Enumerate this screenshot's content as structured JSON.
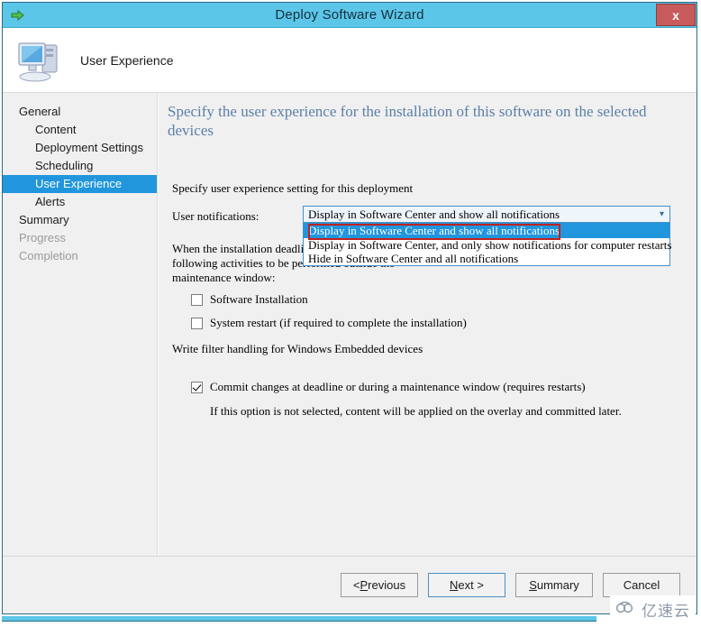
{
  "window": {
    "title": "Deploy Software Wizard",
    "close_label": "x",
    "titlebar_icon": "green-arrow-icon",
    "colors": {
      "titlebar": "#5cc6e8",
      "close_button": "#c75b5b",
      "selection": "#2196dd",
      "heading_text": "#5a7fa8",
      "annotation": "#c0221f"
    }
  },
  "header": {
    "icon": "computer-icon",
    "title": "User Experience"
  },
  "sidebar": {
    "items": [
      {
        "label": "General",
        "indent": false,
        "state": "normal"
      },
      {
        "label": "Content",
        "indent": true,
        "state": "normal"
      },
      {
        "label": "Deployment Settings",
        "indent": true,
        "state": "normal"
      },
      {
        "label": "Scheduling",
        "indent": true,
        "state": "normal"
      },
      {
        "label": "User Experience",
        "indent": true,
        "state": "selected"
      },
      {
        "label": "Alerts",
        "indent": true,
        "state": "normal"
      },
      {
        "label": "Summary",
        "indent": false,
        "state": "normal"
      },
      {
        "label": "Progress",
        "indent": false,
        "state": "disabled"
      },
      {
        "label": "Completion",
        "indent": false,
        "state": "disabled"
      }
    ]
  },
  "main": {
    "heading": "Specify the user experience for the installation of this software on the selected devices",
    "intro": "Specify user experience setting for this deployment",
    "field_label": "User notifications:",
    "combo": {
      "value": "Display in Software Center and show all notifications",
      "arrow_icon": "chevron-down-icon",
      "expanded": true,
      "options": [
        "Display in Software Center and show all notifications",
        "Display in Software Center, and only show notifications for computer restarts",
        "Hide in Software Center and all notifications"
      ],
      "highlighted_index": 0
    },
    "deadline_text": "When the installation deadline is reached, allow the following activities to be performed outside the maintenance window:",
    "checkboxes": [
      {
        "label": "Software Installation",
        "checked": false
      },
      {
        "label": "System restart  (if required to complete the installation)",
        "checked": false
      }
    ],
    "write_filter_heading": "Write filter handling for Windows Embedded devices",
    "commit_checkbox": {
      "label": "Commit changes at deadline or during a maintenance window (requires restarts)",
      "checked": true
    },
    "commit_note": "If this option is not selected, content will be applied on the overlay and committed later."
  },
  "footer": {
    "buttons": [
      {
        "id": "previous",
        "prefix": "< ",
        "accel": "P",
        "rest": "revious",
        "default": false
      },
      {
        "id": "next",
        "prefix": "",
        "accel": "N",
        "rest": "ext >",
        "default": true
      },
      {
        "id": "summary",
        "prefix": "",
        "accel": "S",
        "rest": "ummary",
        "default": false
      },
      {
        "id": "cancel",
        "prefix": "",
        "accel": "",
        "rest": "Cancel",
        "default": false
      }
    ]
  },
  "watermark": {
    "text": "亿速云",
    "icon": "cloud-icon"
  }
}
